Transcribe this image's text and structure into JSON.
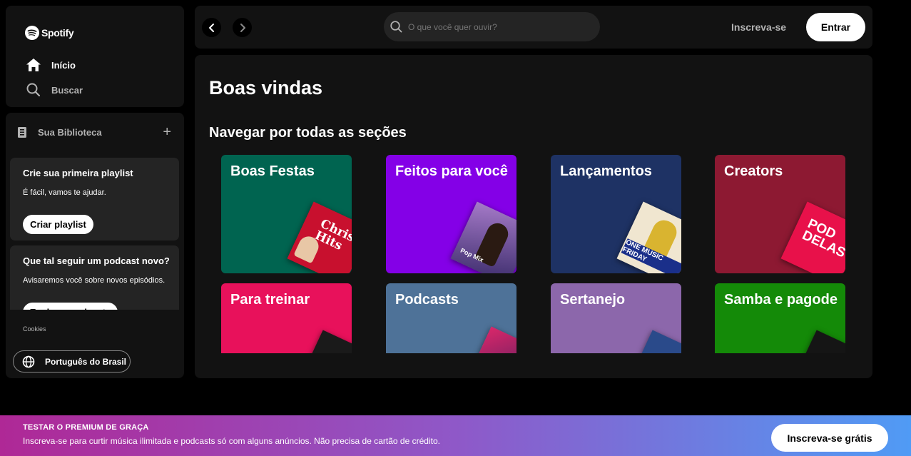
{
  "logo": {
    "wordmark": "Spotify"
  },
  "nav": {
    "home": "Início",
    "search": "Buscar"
  },
  "library": {
    "title": "Sua Biblioteca",
    "add_symbol": "+",
    "card1": {
      "title": "Crie sua primeira playlist",
      "subtitle": "É fácil, vamos te ajudar.",
      "button": "Criar playlist"
    },
    "card2": {
      "title": "Que tal seguir um podcast novo?",
      "subtitle": "Avisaremos você sobre novos episódios.",
      "button": "Explorar podcasts"
    },
    "cookies": "Cookies",
    "language": "Português do Brasil"
  },
  "topbar": {
    "search_placeholder": "O que você quer ouvir?",
    "signup": "Inscreva-se",
    "login": "Entrar"
  },
  "main": {
    "heading": "Boas vindas",
    "section_title": "Navegar por todas as seções",
    "tiles": [
      {
        "label": "Boas Festas",
        "color": "#006450",
        "art_text": "Christmas Hits"
      },
      {
        "label": "Feitos para você",
        "color": "#8400e7",
        "art_text": "Pop Mix"
      },
      {
        "label": "Lançamentos",
        "color": "#1e3264",
        "art_text": "ONE MUSIC FRIDAY"
      },
      {
        "label": "Creators",
        "color": "#8d1932",
        "art_text": "POD DELAS"
      },
      {
        "label": "Para treinar",
        "color": "#e8115b",
        "art_text": ""
      },
      {
        "label": "Podcasts",
        "color": "#4e7298",
        "art_text": ""
      },
      {
        "label": "Sertanejo",
        "color": "#8c67ab",
        "art_text": ""
      },
      {
        "label": "Samba e pagode",
        "color": "#148a08",
        "art_text": ""
      }
    ]
  },
  "banner": {
    "title": "TESTAR O PREMIUM DE GRAÇA",
    "text": "Inscreva-se para curtir música ilimitada e podcasts só com alguns anúncios. Não precisa de cartão de crédito.",
    "button": "Inscreva-se grátis"
  }
}
